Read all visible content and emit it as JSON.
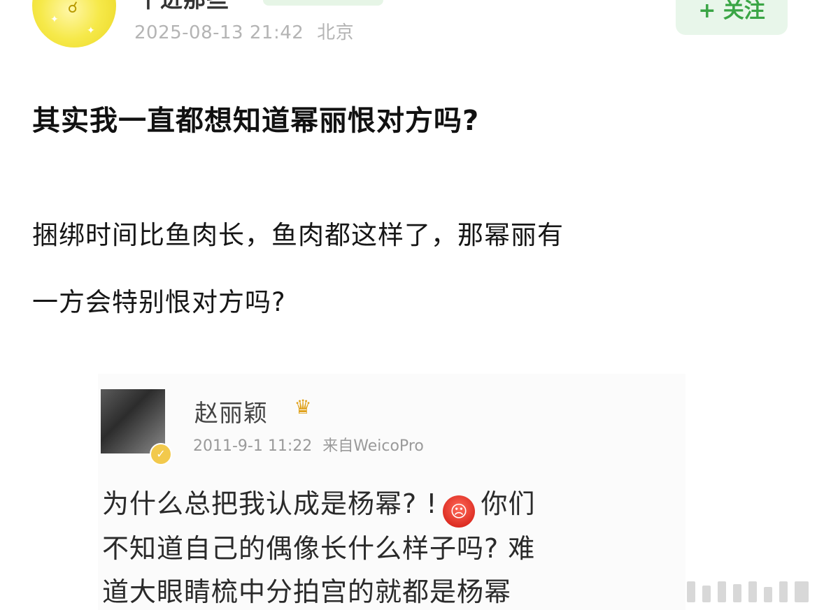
{
  "header": {
    "username": "千进那些",
    "timestamp": "2025-08-13 21:42",
    "location": "北京",
    "follow_label": "+ 关注"
  },
  "post": {
    "title": "其实我一直都想知道幂丽恨对方吗?",
    "body_lines": [
      "捆绑时间比鱼肉长，鱼肉都这样了，那幂丽有",
      "一方会特别恨对方吗?"
    ]
  },
  "quoted": {
    "name": "赵丽颖",
    "time": "2011-9-1 11:22",
    "source": "来自WeicoPro",
    "line1_before": "为什么总把我认成是杨幂? !",
    "line1_after": "你们",
    "line2": "不知道自己的偶像长什么样子吗? 难",
    "line3": "道大眼睛梳中分拍宫的就都是杨幂",
    "emoji": "angry-face"
  },
  "colors": {
    "follow_green": "#3aa545",
    "follow_bg": "#e8f6ea",
    "avatar_yellow": "#f6e94a"
  }
}
